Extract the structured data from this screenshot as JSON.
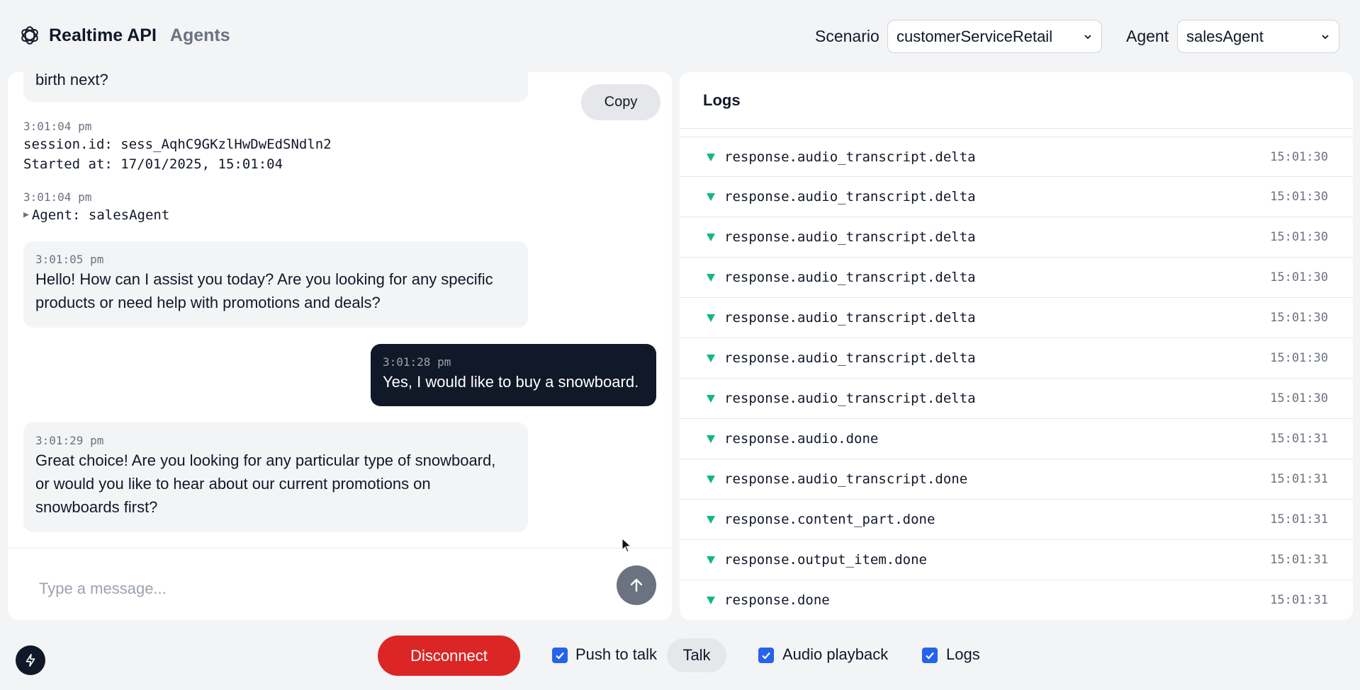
{
  "header": {
    "title": "Realtime API",
    "subtitle": "Agents",
    "scenario_label": "Scenario",
    "scenario_value": "customerServiceRetail",
    "agent_label": "Agent",
    "agent_value": "salesAgent"
  },
  "transcript": {
    "copy_label": "Copy",
    "partial_message": "birth next?",
    "session": {
      "time": "3:01:04 pm",
      "id_line": "session.id: sess_AqhC9GKzlHwDwEdSNdln2",
      "started_line": "Started at: 17/01/2025, 15:01:04"
    },
    "agent_event": {
      "time": "3:01:04 pm",
      "text": "Agent: salesAgent"
    },
    "messages": [
      {
        "role": "assistant",
        "time": "3:01:05 pm",
        "lines": [
          "Hello! How can I assist you today? Are you looking for any specific",
          "products or need help with promotions and deals?"
        ]
      },
      {
        "role": "user",
        "time": "3:01:28 pm",
        "lines": [
          "Yes, I would like to buy a snowboard."
        ]
      },
      {
        "role": "assistant",
        "time": "3:01:29 pm",
        "lines": [
          "Great choice! Are you looking for any particular type of snowboard,",
          "or would you like to hear about our current promotions on",
          "snowboards first?"
        ]
      }
    ],
    "input_placeholder": "Type a message..."
  },
  "logs": {
    "title": "Logs",
    "rows": [
      {
        "name": "response.audio_transcript.delta",
        "time": "15:01:30"
      },
      {
        "name": "response.audio_transcript.delta",
        "time": "15:01:30"
      },
      {
        "name": "response.audio_transcript.delta",
        "time": "15:01:30"
      },
      {
        "name": "response.audio_transcript.delta",
        "time": "15:01:30"
      },
      {
        "name": "response.audio_transcript.delta",
        "time": "15:01:30"
      },
      {
        "name": "response.audio_transcript.delta",
        "time": "15:01:30"
      },
      {
        "name": "response.audio_transcript.delta",
        "time": "15:01:30"
      },
      {
        "name": "response.audio.done",
        "time": "15:01:31"
      },
      {
        "name": "response.audio_transcript.done",
        "time": "15:01:31"
      },
      {
        "name": "response.content_part.done",
        "time": "15:01:31"
      },
      {
        "name": "response.output_item.done",
        "time": "15:01:31"
      },
      {
        "name": "response.done",
        "time": "15:01:31"
      }
    ]
  },
  "toolbar": {
    "disconnect_label": "Disconnect",
    "push_to_talk_label": "Push to talk",
    "push_to_talk_checked": true,
    "talk_label": "Talk",
    "audio_playback_label": "Audio playback",
    "audio_playback_checked": true,
    "logs_label": "Logs",
    "logs_checked": true
  },
  "colors": {
    "disconnect": "#dc2626",
    "checkbox": "#2563eb",
    "log_arrow": "#10b981",
    "user_bubble": "#111827",
    "assistant_bubble": "#f3f4f6"
  },
  "icons": [
    "openai-logo-icon",
    "chevron-down-icon",
    "arrow-up-icon",
    "triangle-down-icon",
    "check-icon",
    "bolt-icon",
    "cursor-icon"
  ]
}
